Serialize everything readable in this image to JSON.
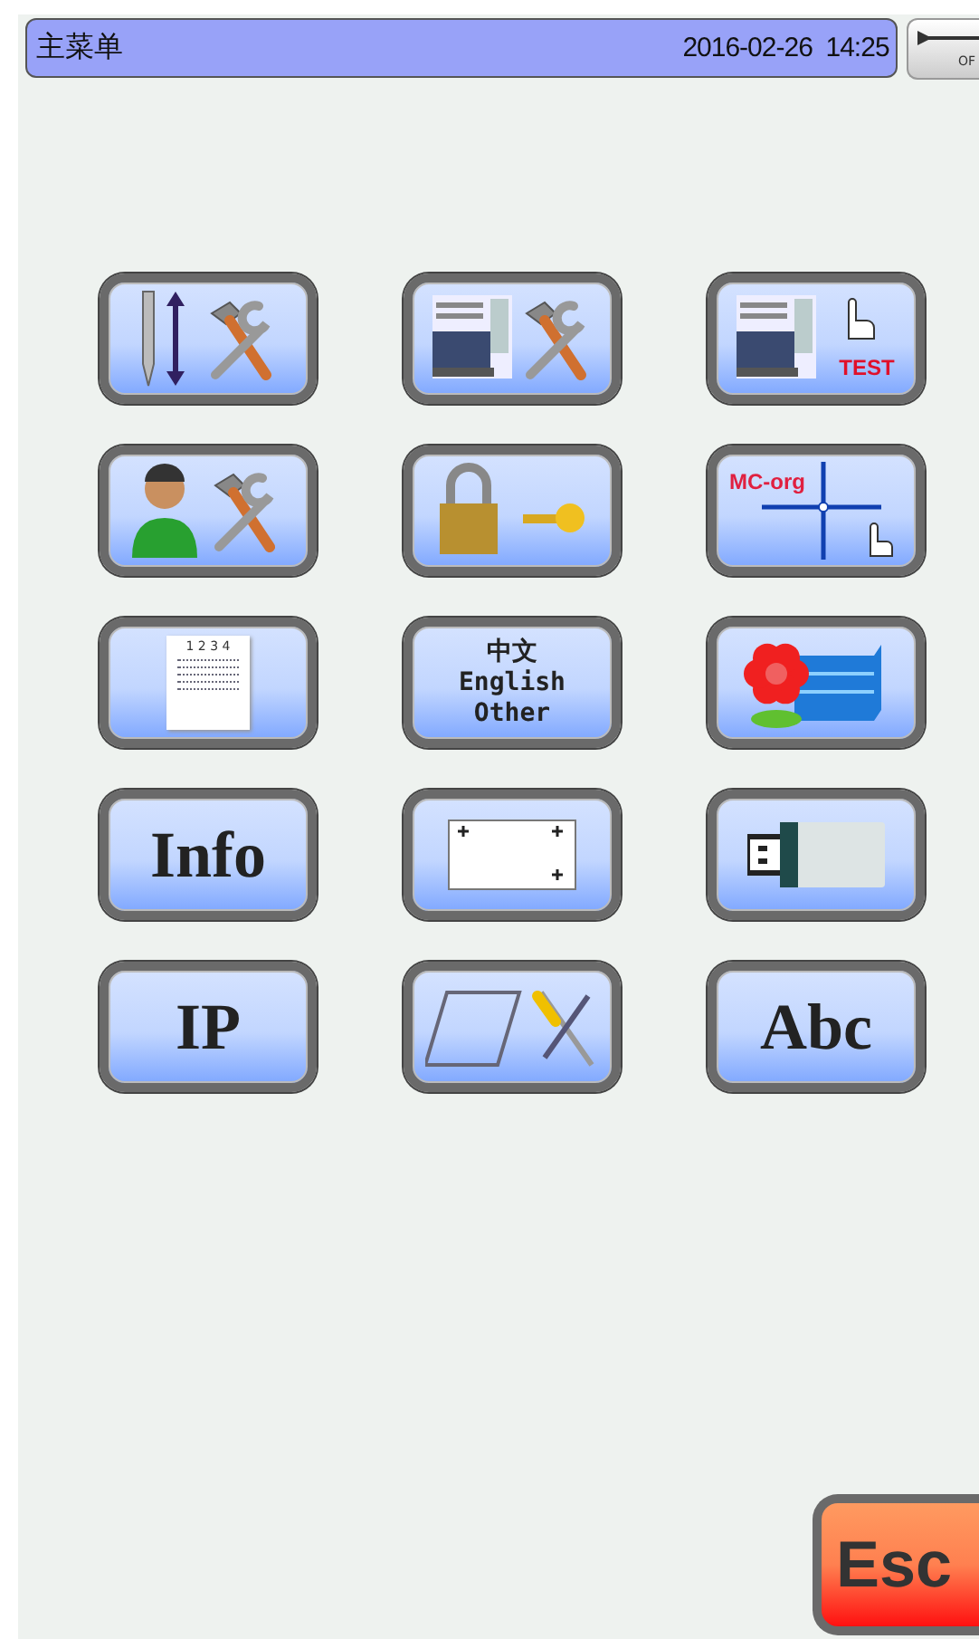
{
  "title_bar": {
    "title": "主菜单",
    "datetime": "2016-02-26  14:25"
  },
  "power_switch": {
    "label": "OF",
    "on": false
  },
  "menu_buttons": [
    {
      "kind": "needle-tools"
    },
    {
      "kind": "machine-tools"
    },
    {
      "kind": "machine-test",
      "text": "TEST"
    },
    {
      "kind": "user-tools"
    },
    {
      "kind": "lock-key"
    },
    {
      "kind": "origin",
      "text": "MC-org"
    },
    {
      "kind": "document",
      "text": "1 2 3 4"
    },
    {
      "kind": "language",
      "lines": [
        "中文",
        "English",
        "Other"
      ]
    },
    {
      "kind": "flower-layers"
    },
    {
      "kind": "word",
      "text": "Info"
    },
    {
      "kind": "frame"
    },
    {
      "kind": "usb"
    },
    {
      "kind": "word",
      "text": "IP"
    },
    {
      "kind": "frame-tools"
    },
    {
      "kind": "word",
      "text": "Abc"
    }
  ],
  "esc_button": {
    "label": "Esc"
  }
}
